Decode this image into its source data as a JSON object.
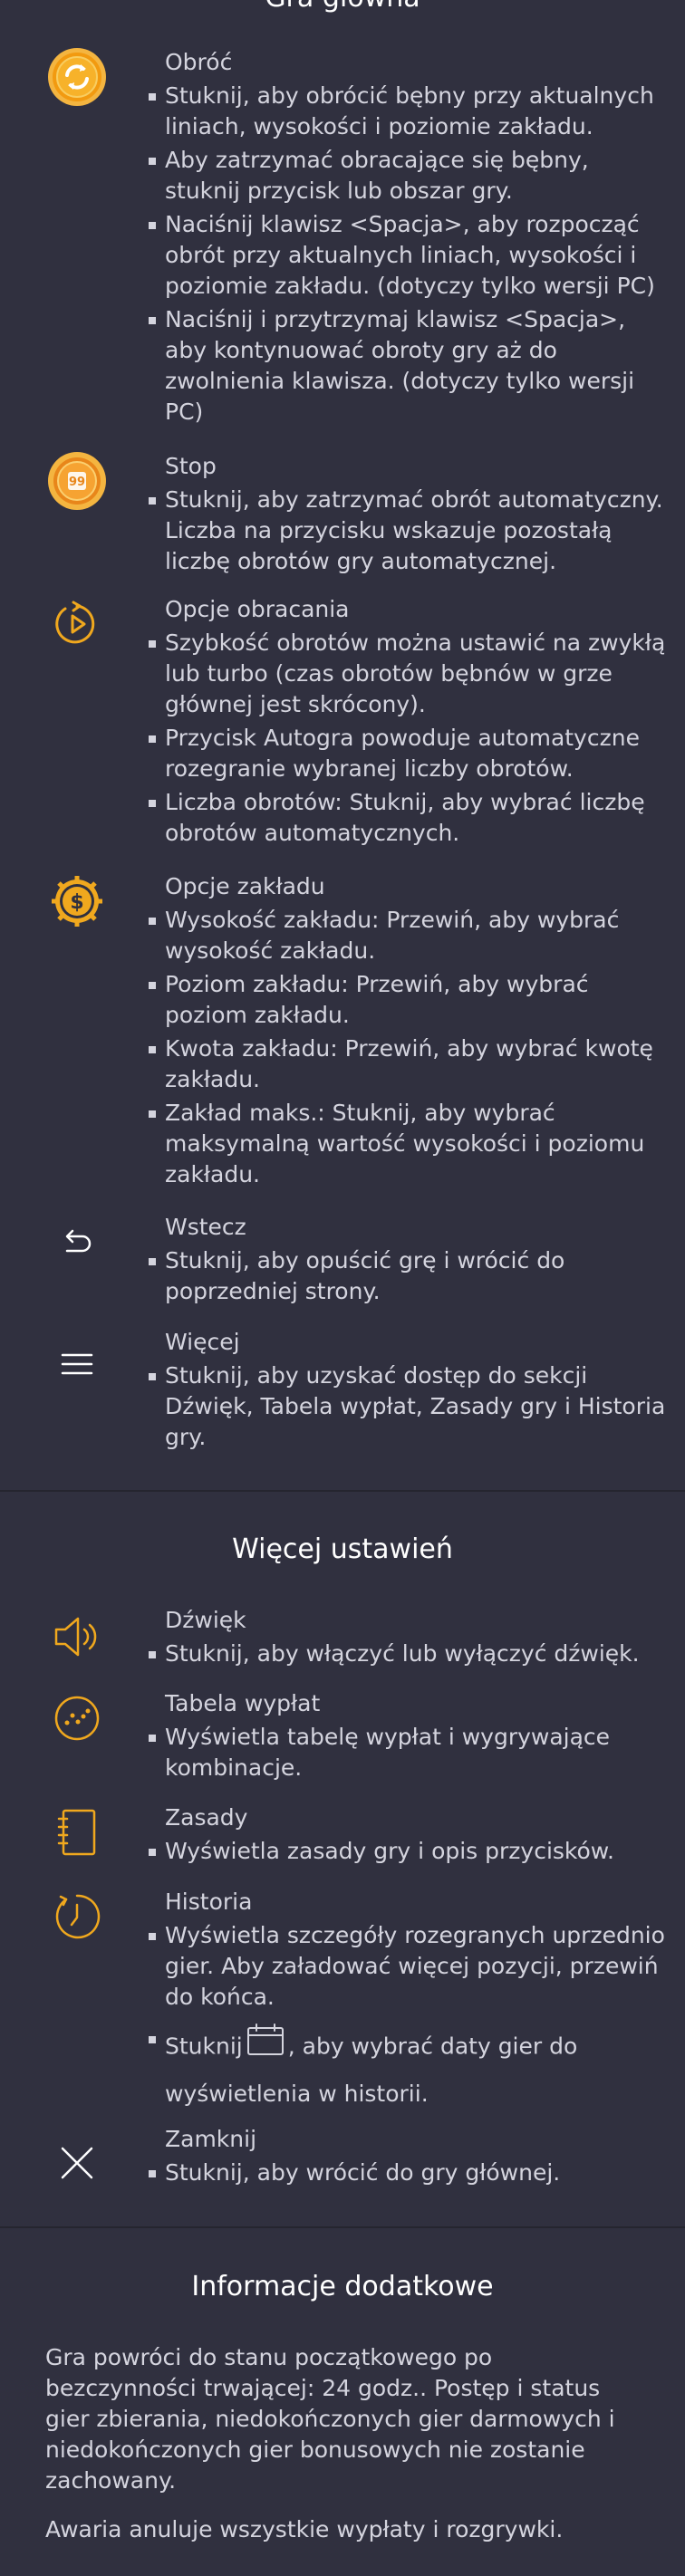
{
  "main_game": {
    "title": "Gra główna",
    "spin": {
      "title": "Obróć",
      "bullets": [
        "Stuknij, aby obrócić bębny przy aktualnych liniach, wysokości i poziomie zakładu.",
        "Aby zatrzymać obracające się bębny, stuknij przycisk lub obszar gry.",
        "Naciśnij klawisz <Spacja>, aby rozpocząć obrót przy aktualnych liniach, wysokości i poziomie zakładu. (dotyczy tylko wersji PC)",
        "Naciśnij i przytrzymaj klawisz <Spacja>, aby kontynuować obroty gry aż do zwolnienia klawisza. (dotyczy tylko wersji PC)"
      ]
    },
    "stop": {
      "title": "Stop",
      "badge": "99",
      "bullets": [
        "Stuknij, aby zatrzymać obrót automatyczny. Liczba na przycisku wskazuje pozostałą liczbę obrotów gry automatycznej."
      ]
    },
    "spin_options": {
      "title": "Opcje obracania",
      "bullets": [
        "Szybkość obrotów można ustawić na zwykłą lub turbo (czas obrotów bębnów w grze głównej jest skrócony).",
        "Przycisk Autogra powoduje automatyczne rozegranie wybranej liczby obrotów.",
        "Liczba obrotów: Stuknij, aby wybrać liczbę obrotów automatycznych."
      ]
    },
    "bet_options": {
      "title": "Opcje zakładu",
      "bullets": [
        "Wysokość zakładu: Przewiń, aby wybrać wysokość zakładu.",
        "Poziom zakładu: Przewiń, aby wybrać poziom zakładu.",
        "Kwota zakładu: Przewiń, aby wybrać kwotę zakładu.",
        "Zakład maks.: Stuknij, aby wybrać maksymalną wartość wysokości i poziomu zakładu."
      ]
    },
    "back": {
      "title": "Wstecz",
      "bullets": [
        "Stuknij, aby opuścić grę i wrócić do poprzedniej strony."
      ]
    },
    "more": {
      "title": "Więcej",
      "bullets": [
        "Stuknij, aby uzyskać dostęp do sekcji Dźwięk, Tabela wypłat, Zasady gry i Historia gry."
      ]
    }
  },
  "more_settings": {
    "title": "Więcej ustawień",
    "sound": {
      "title": "Dźwięk",
      "bullets": [
        "Stuknij, aby włączyć lub wyłączyć dźwięk."
      ]
    },
    "paytable": {
      "title": "Tabela wypłat",
      "bullets": [
        "Wyświetla tabelę wypłat i wygrywające kombinacje."
      ]
    },
    "rules": {
      "title": "Zasady",
      "bullets": [
        "Wyświetla zasady gry i opis przycisków."
      ]
    },
    "history": {
      "title": "Historia",
      "bullets": [
        "Wyświetla szczegóły rozegranych uprzednio gier. Aby załadować więcej pozycji, przewiń do końca."
      ],
      "date_bullet_pre": "Stuknij",
      "date_bullet_post": ", aby wybrać daty gier do wyświetlenia w historii."
    },
    "close": {
      "title": "Zamknij",
      "bullets": [
        "Stuknij, aby wrócić do gry głównej."
      ]
    }
  },
  "additional_info": {
    "title": "Informacje dodatkowe",
    "paragraphs": [
      "Gra powróci do stanu początkowego po bezczynności trwającej: 24 godz.. Postęp i status gier zbierania, niedokończonych gier darmowych i niedokończonych gier bonusowych nie zostanie zachowany.",
      "Awaria anuluje wszystkie wypłaty i rozgrywki."
    ]
  },
  "colors": {
    "background": "#30303f",
    "accent": "#f0a81e",
    "text": "#d4d4de"
  }
}
